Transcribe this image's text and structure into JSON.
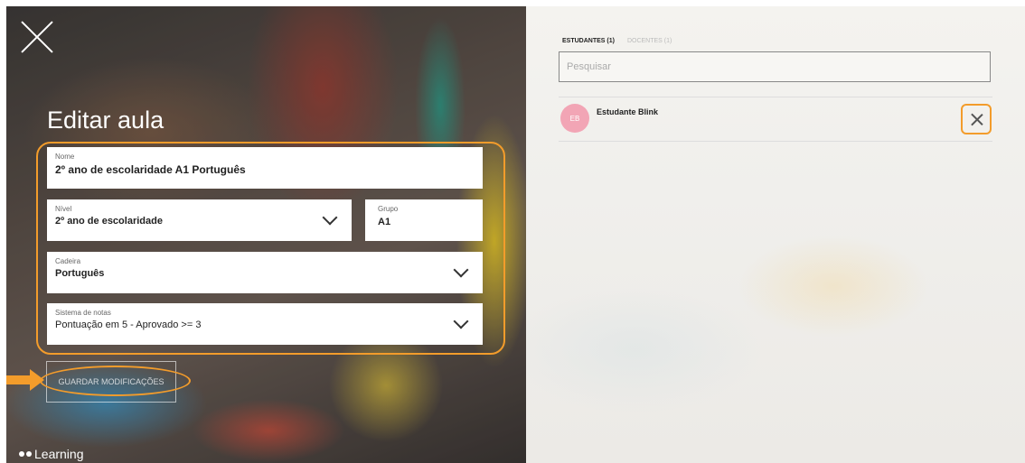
{
  "editor": {
    "title": "Editar aula",
    "fields": {
      "name": {
        "label": "Nome",
        "value": "2º ano de escolaridade A1 Português"
      },
      "level": {
        "label": "Nível",
        "value": "2º ano de escolaridade"
      },
      "group": {
        "label": "Grupo",
        "value": "A1"
      },
      "subject": {
        "label": "Cadeira",
        "value": "Português"
      },
      "grading": {
        "label": "Sistema de notas",
        "value": "Pontuação em 5 - Aprovado >= 3"
      }
    },
    "save_label": "GUARDAR MODIFICAÇÕES",
    "logo_text": "Learning"
  },
  "members": {
    "tabs": [
      {
        "label": "ESTUDANTES (1)",
        "active": true
      },
      {
        "label": "DOCENTES (1)",
        "active": false
      }
    ],
    "search_placeholder": "Pesquisar",
    "students": [
      {
        "initials": "EB",
        "name": "Estudante Blink"
      }
    ]
  },
  "colors": {
    "highlight": "#f39c2b",
    "avatar": "#f2a5b5"
  }
}
